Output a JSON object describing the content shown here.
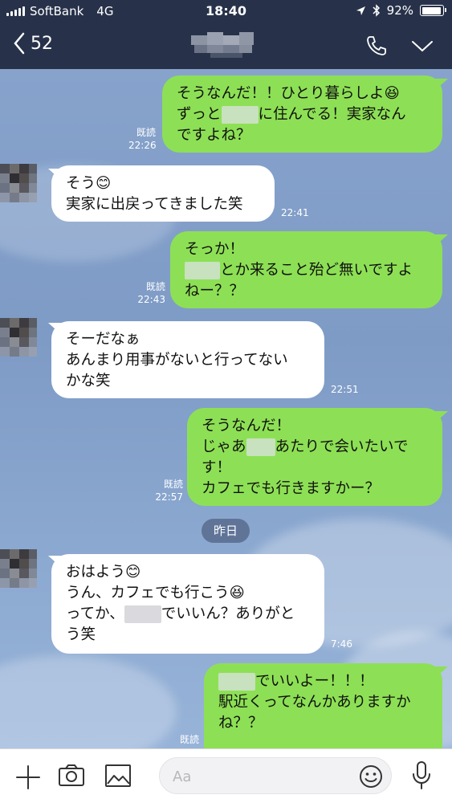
{
  "status_bar": {
    "carrier": "SoftBank",
    "network": "4G",
    "time": "18:40",
    "battery": "92%",
    "battery_level": 0.92
  },
  "header": {
    "back_count": "52",
    "call_icon": "phone-icon",
    "menu_icon": "chevron-down-icon"
  },
  "messages": [
    {
      "from": "me",
      "text_a": "そうなんだ！！ひとり暮らしよ😆\nずっと",
      "text_b": "に住んでる！実家なん\nですよね？",
      "read": "既読",
      "time": "22:26"
    },
    {
      "from": "them",
      "text": "そう😊\n実家に出戻ってきました笑",
      "time": "22:41"
    },
    {
      "from": "me",
      "text_a": "そっか！\n",
      "text_b": "とか来ること殆ど無いですよ\nねー？？",
      "read": "既読",
      "time": "22:43"
    },
    {
      "from": "them",
      "text": "そーだなぁ\nあんまり用事がないと行ってない\nかな笑",
      "time": "22:51"
    },
    {
      "from": "me",
      "text_a": "そうなんだ！\nじゃあ",
      "text_b": "あたりで会いたいで\nす！\nカフェでも行きますかー？",
      "read": "既読",
      "time": "22:57"
    },
    {
      "from": "them",
      "text_a": "おはよう😊\nうん、カフェでも行こう😆\nってか、",
      "text_b": "でいいん？ありがと\nう笑",
      "time": "7:46"
    },
    {
      "from": "me",
      "text_a": "",
      "text_b": "でいいよー！！！\n駅近くってなんかありますか\nね？？",
      "read": "既読"
    }
  ],
  "date_separator": "昨日",
  "input": {
    "placeholder": "Aa",
    "value": ""
  },
  "toolbar": {
    "plus_icon": "plus-icon",
    "camera_icon": "camera-icon",
    "image_icon": "image-icon",
    "emoji_icon": "emoji-icon",
    "mic_icon": "microphone-icon"
  },
  "colors": {
    "header_bg": "#27324a",
    "my_bubble": "#8de055",
    "their_bubble": "#ffffff",
    "chat_bg": "#7f9dc7"
  }
}
